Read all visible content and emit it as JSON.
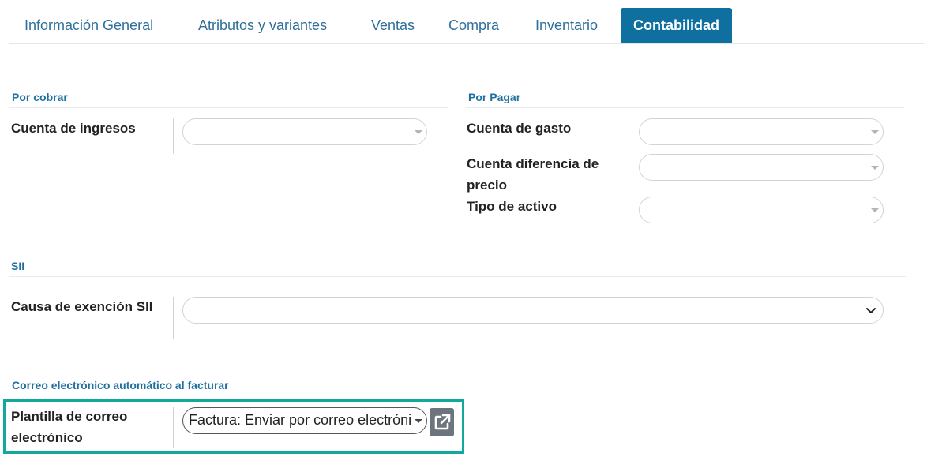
{
  "tabs": [
    {
      "label": "Información General"
    },
    {
      "label": "Atributos y variantes"
    },
    {
      "label": "Ventas"
    },
    {
      "label": "Compra"
    },
    {
      "label": "Inventario"
    },
    {
      "label": "Contabilidad",
      "active": true
    }
  ],
  "receivable": {
    "title": "Por cobrar",
    "fields": [
      {
        "label": "Cuenta de ingresos",
        "value": ""
      }
    ]
  },
  "payable": {
    "title": "Por Pagar",
    "fields": [
      {
        "label": "Cuenta de gasto",
        "value": ""
      },
      {
        "label": "Cuenta diferencia de precio",
        "value": ""
      },
      {
        "label": "Tipo de activo",
        "value": ""
      }
    ]
  },
  "sii": {
    "title": "SII",
    "fields": [
      {
        "label": "Causa de exención SII",
        "value": ""
      }
    ]
  },
  "auto_email": {
    "title": "Correo electrónico automático al facturar",
    "fields": [
      {
        "label": "Plantilla de correo electrónico",
        "value": "Factura: Enviar por correo electrónico"
      }
    ]
  },
  "colors": {
    "accent": "#0f6f9f",
    "highlight": "#12a89d",
    "section_title": "#1f6f9f"
  },
  "icons": {
    "external_link": "external-link-icon",
    "dropdown": "caret-down-icon",
    "select_chevron": "chevron-down-icon"
  }
}
